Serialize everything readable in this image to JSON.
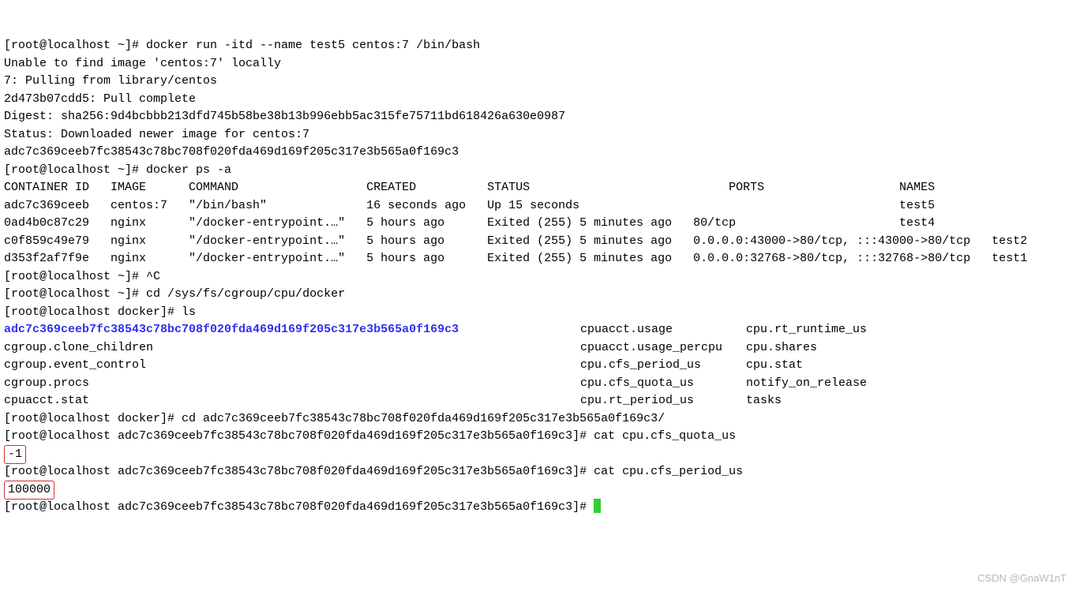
{
  "prompt_home": "[root@localhost ~]# ",
  "prompt_docker": "[root@localhost docker]# ",
  "prompt_long": "[root@localhost adc7c369ceeb7fc38543c78bc708f020fda469d169f205c317e3b565a0f169c3]# ",
  "cmd_docker_run": "docker run -itd --name test5 centos:7 /bin/bash",
  "pull_no_image": "Unable to find image 'centos:7' locally",
  "pull_from": "7: Pulling from library/centos",
  "pull_layer": "2d473b07cdd5: Pull complete",
  "pull_digest": "Digest: sha256:9d4bcbbb213dfd745b58be38b13b996ebb5ac315fe75711bd618426a630e0987",
  "pull_status": "Status: Downloaded newer image for centos:7",
  "pull_cid": "adc7c369ceeb7fc38543c78bc708f020fda469d169f205c317e3b565a0f169c3",
  "cmd_docker_ps": "docker ps -a",
  "ps_header": "CONTAINER ID   IMAGE      COMMAND                  CREATED          STATUS                            PORTS                   NAMES",
  "ps_row1": "adc7c369ceeb   centos:7   \"/bin/bash\"              16 seconds ago   Up 15 seconds                                             test5",
  "ps_row2": "0ad4b0c87c29   nginx      \"/docker-entrypoint.…\"   5 hours ago      Exited (255) 5 minutes ago   80/tcp                       test4",
  "ps_row3": "c0f859c49e79   nginx      \"/docker-entrypoint.…\"   5 hours ago      Exited (255) 5 minutes ago   0.0.0.0:43000->80/tcp, :::43000->80/tcp   test2",
  "ps_row4": "d353f2af7f9e   nginx      \"/docker-entrypoint.…\"   5 hours ago      Exited (255) 5 minutes ago   0.0.0.0:32768->80/tcp, :::32768->80/tcp   test1",
  "cmd_ctrlc": "^C",
  "cmd_cd_cgroup": "cd /sys/fs/cgroup/cpu/docker",
  "cmd_ls": "ls",
  "ls_rows": [
    [
      "adc7c369ceeb7fc38543c78bc708f020fda469d169f205c317e3b565a0f169c3",
      "cpuacct.usage",
      "cpu.rt_runtime_us"
    ],
    [
      "cgroup.clone_children",
      "cpuacct.usage_percpu",
      "cpu.shares"
    ],
    [
      "cgroup.event_control",
      "cpu.cfs_period_us",
      "cpu.stat"
    ],
    [
      "cgroup.procs",
      "cpu.cfs_quota_us",
      "notify_on_release"
    ],
    [
      "cpuacct.stat",
      "cpu.rt_period_us",
      "tasks"
    ]
  ],
  "cmd_cd_long": "cd adc7c369ceeb7fc38543c78bc708f020fda469d169f205c317e3b565a0f169c3/",
  "cmd_cat_quota": "cat cpu.cfs_quota_us",
  "value_quota": "-1",
  "cmd_cat_period": "cat cpu.cfs_period_us",
  "value_period": "100000",
  "watermark": "CSDN @GnaW1nT"
}
